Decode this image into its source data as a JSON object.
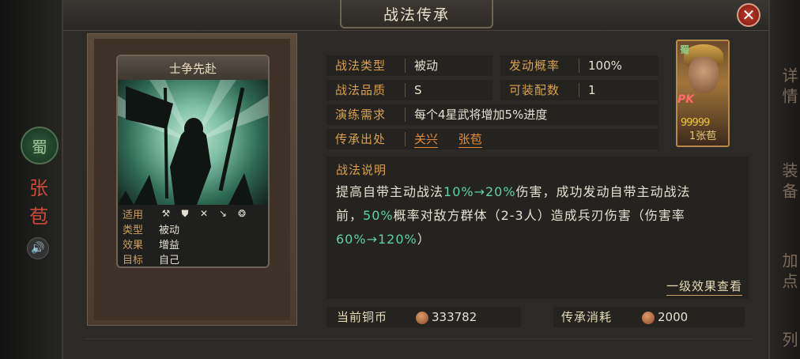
{
  "dialog": {
    "title": "战法传承",
    "close_label": "✕"
  },
  "background": {
    "faction_seal": "蜀",
    "hero_name_vertical": "张苞",
    "sound_icon": "🔊"
  },
  "side_tabs": [
    "详情",
    "装备",
    "加点",
    "列"
  ],
  "skill_card": {
    "name": "士争先赴",
    "stats": [
      {
        "key": "适用",
        "icons": [
          "axe-icon",
          "shield-icon",
          "crossed-bows-icon",
          "spear-icon",
          "wheel-icon"
        ]
      },
      {
        "key": "类型",
        "value": "被动"
      },
      {
        "key": "效果",
        "value": "增益"
      },
      {
        "key": "目标",
        "value": "自己"
      }
    ]
  },
  "info": {
    "type_label": "战法类型",
    "type_value": "被动",
    "trigger_label": "发动概率",
    "trigger_value": "100%",
    "quality_label": "战法品质",
    "quality_value": "S",
    "equip_label": "可装配数",
    "equip_value": "1",
    "drill_label": "演练需求",
    "drill_value": "每个4星武将增加5%进度",
    "source_label": "传承出处",
    "source_1": "关兴",
    "source_2": "张苞"
  },
  "portrait": {
    "faction": "蜀",
    "pk_badge": "PK",
    "stars": "99999",
    "name": "1张苞"
  },
  "description": {
    "title": "战法说明",
    "t1": "提高自带主动战法",
    "h1": "10%→20%",
    "t2": "伤害，成功发动自带主动战法",
    "t3": "前，",
    "h2": "50%",
    "t4": "概率对敌方群体（2-3人）造成兵刃伤害（伤害率",
    "h3": "60%→120%",
    "t5": "）",
    "more_link": "一级效果查看"
  },
  "currency": {
    "copper_label": "当前铜币",
    "copper_value": "333782",
    "cost_label": "传承消耗",
    "cost_value": "2000"
  },
  "colors": {
    "accent_orange": "#d9a14e",
    "highlight_teal": "#5fd0a8",
    "link_orange": "#e38b3a",
    "close_red": "#c0392b"
  }
}
